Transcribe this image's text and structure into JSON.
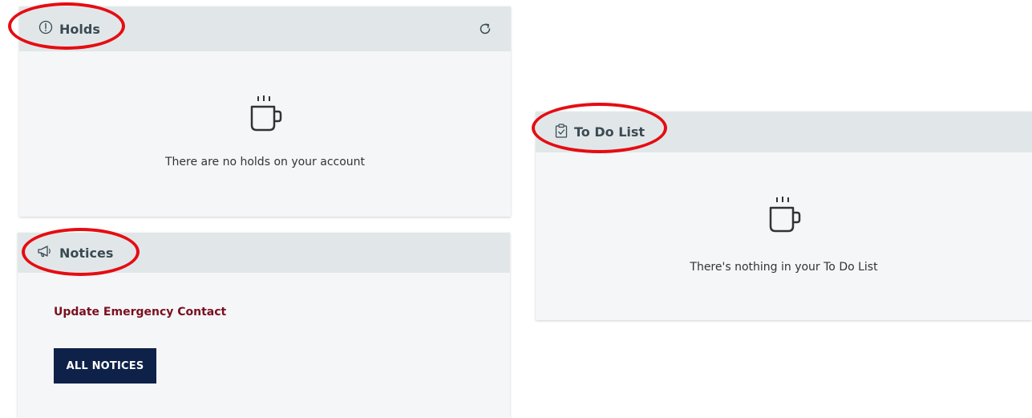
{
  "holds": {
    "title": "Holds",
    "header_icon": "exclamation-circle-icon",
    "refresh_icon": "refresh-icon",
    "empty_icon": "coffee-mug-icon",
    "empty_message": "There are no holds on your account"
  },
  "notices": {
    "title": "Notices",
    "header_icon": "megaphone-icon",
    "link_label": "Update Emergency Contact",
    "button_label": "ALL NOTICES"
  },
  "todo": {
    "title": "To Do List",
    "header_icon": "clipboard-check-icon",
    "empty_icon": "coffee-mug-icon",
    "empty_message": "There's nothing in your To Do List"
  },
  "colors": {
    "header_bg": "#e1e7e9",
    "card_bg": "#f5f6f7",
    "link_maroon": "#7a1020",
    "button_navy": "#0e2148",
    "annotation_red": "#e50d12"
  }
}
